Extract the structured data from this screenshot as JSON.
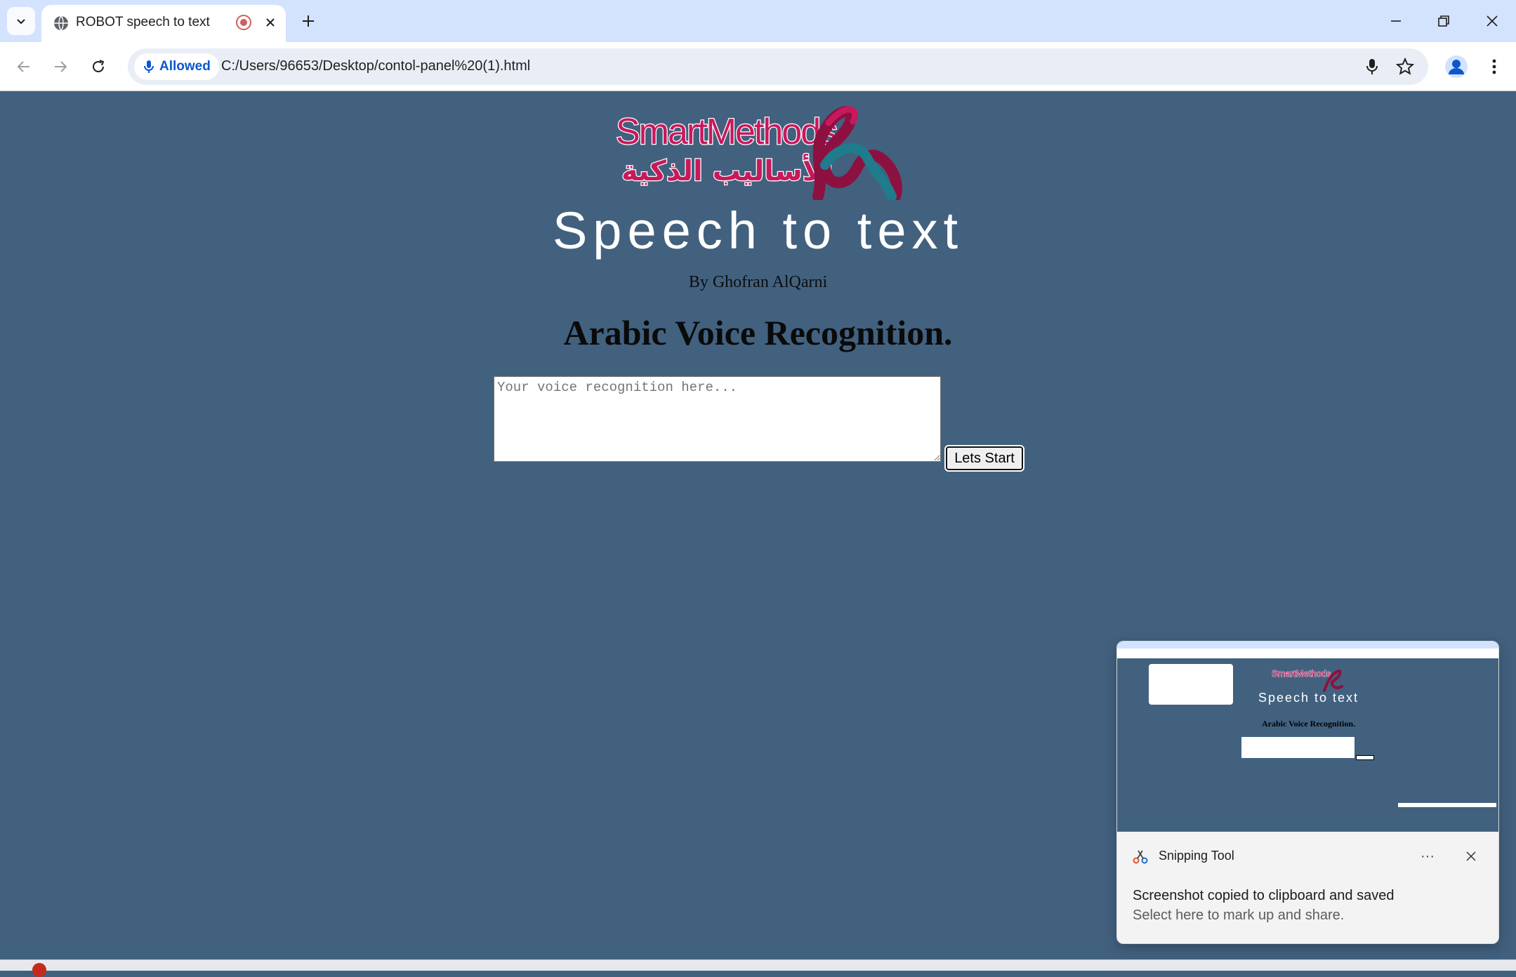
{
  "browser": {
    "tab_title": "ROBOT speech to text",
    "permission_label": "Allowed",
    "url": "C:/Users/96653/Desktop/contol-panel%20(1).html"
  },
  "page": {
    "logo_text_latin": "SmartMethods",
    "logo_text_arabic": "الأساليب الذكية",
    "headline": "Speech to text",
    "byline": "By Ghofran AlQarni",
    "subheading": "Arabic Voice Recognition.",
    "textarea_placeholder": "Your voice recognition here...",
    "start_button": "Lets Start"
  },
  "colors": {
    "page_background": "#42617f",
    "logo_magenta": "#c8195c",
    "logo_teal": "#1e7c8c"
  },
  "toast": {
    "app_name": "Snipping Tool",
    "more_label": "···",
    "message": "Screenshot copied to clipboard and saved",
    "hint": "Select here to mark up and share.",
    "preview_title": "Speech to text",
    "preview_sub": "Arabic Voice Recognition."
  }
}
